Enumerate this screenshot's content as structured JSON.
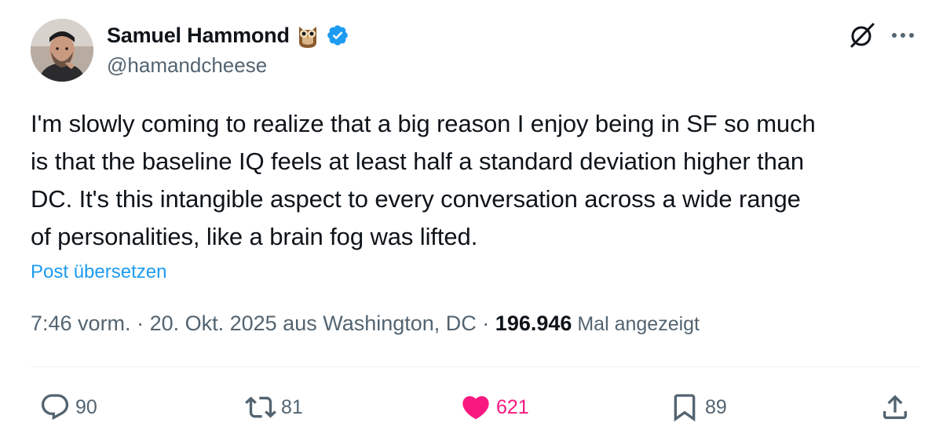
{
  "author": {
    "display_name": "Samuel Hammond",
    "emoji": "owl-icon",
    "verified": true,
    "handle": "@hamandcheese"
  },
  "tweet": {
    "text": "I'm slowly coming to realize that a big reason I enjoy being in SF so much\nis that the baseline IQ feels at least half a standard deviation higher than\nDC. It's this intangible aspect to every conversation across a wide range\nof personalities, like a brain fog was lifted.",
    "translate_label": "Post übersetzen"
  },
  "meta": {
    "time": "7:46 vorm.",
    "sep1": " · ",
    "date": "20. Okt. 2025",
    "location": " aus Washington, DC",
    "sep2": " · ",
    "views": "196.946",
    "views_label": " Mal angezeigt"
  },
  "actions": {
    "replies": "90",
    "reposts": "81",
    "likes": "621",
    "bookmarks": "89"
  },
  "colors": {
    "accent": "#1d9bf0",
    "like": "#f91880",
    "secondary_text": "#536471"
  }
}
